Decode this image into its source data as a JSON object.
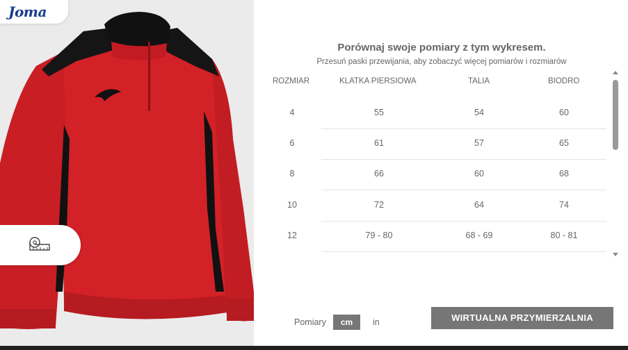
{
  "brand": {
    "logo_text": "Joma"
  },
  "product": {
    "image_icon": "red-black-quarter-zip-sweatshirt"
  },
  "measure_button": {
    "icon": "measuring-tape-icon"
  },
  "chart": {
    "title": "Porównaj swoje pomiary z tym wykresem.",
    "subtitle": "Przesuń paski przewijania, aby zobaczyć więcej pomiarów i rozmiarów",
    "columns": [
      "ROZMIAR",
      "KLATKA PIERSIOWA",
      "TALIA",
      "BIODRO"
    ],
    "rows": [
      [
        "4",
        "55",
        "54",
        "60"
      ],
      [
        "6",
        "61",
        "57",
        "65"
      ],
      [
        "8",
        "66",
        "60",
        "68"
      ],
      [
        "10",
        "72",
        "64",
        "74"
      ],
      [
        "12",
        "79 - 80",
        "68 - 69",
        "80 - 81"
      ]
    ]
  },
  "units": {
    "label": "Pomiary",
    "cm": "cm",
    "in": "in",
    "selected": "cm"
  },
  "virtual_fitting": {
    "label": "WIRTUALNA PRZYMIERZALNIA"
  },
  "colors": {
    "accent_gray": "#767676",
    "brand_blue": "#1a3d8f",
    "product_red": "#d9232a"
  }
}
